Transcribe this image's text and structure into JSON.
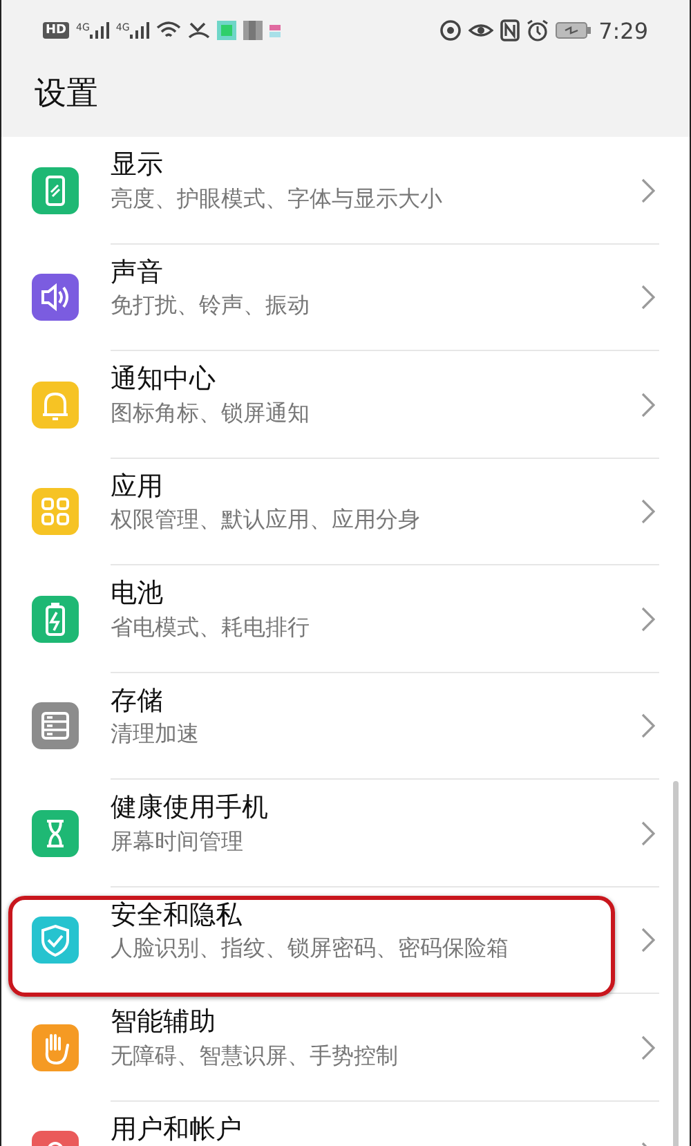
{
  "status_bar": {
    "hd": "HD",
    "networks": [
      "4G",
      "4G"
    ],
    "time": "7:29"
  },
  "header": {
    "title": "设置"
  },
  "items": [
    {
      "title": "显示",
      "subtitle": "亮度、护眼模式、字体与显示大小",
      "kind": "display",
      "color": "#1eb874",
      "highlighted": false
    },
    {
      "title": "声音",
      "subtitle": "免打扰、铃声、振动",
      "kind": "sound",
      "color": "#7b5ce0",
      "highlighted": false
    },
    {
      "title": "通知中心",
      "subtitle": "图标角标、锁屏通知",
      "kind": "bell",
      "color": "#f6c324",
      "highlighted": false
    },
    {
      "title": "应用",
      "subtitle": "权限管理、默认应用、应用分身",
      "kind": "apps",
      "color": "#f6c324",
      "highlighted": false
    },
    {
      "title": "电池",
      "subtitle": "省电模式、耗电排行",
      "kind": "battery",
      "color": "#1eb874",
      "highlighted": false
    },
    {
      "title": "存储",
      "subtitle": "清理加速",
      "kind": "storage",
      "color": "#8c8c8c",
      "highlighted": false
    },
    {
      "title": "健康使用手机",
      "subtitle": "屏幕时间管理",
      "kind": "hourglass",
      "color": "#1eb874",
      "highlighted": false
    },
    {
      "title": "安全和隐私",
      "subtitle": "人脸识别、指纹、锁屏密码、密码保险箱",
      "kind": "shield",
      "color": "#26c3cf",
      "highlighted": true
    },
    {
      "title": "智能辅助",
      "subtitle": "无障碍、智慧识屏、手势控制",
      "kind": "hand",
      "color": "#f59a23",
      "highlighted": false
    },
    {
      "title": "用户和帐户",
      "kind": "user",
      "color": "#ea5a5a",
      "highlighted": false
    }
  ]
}
